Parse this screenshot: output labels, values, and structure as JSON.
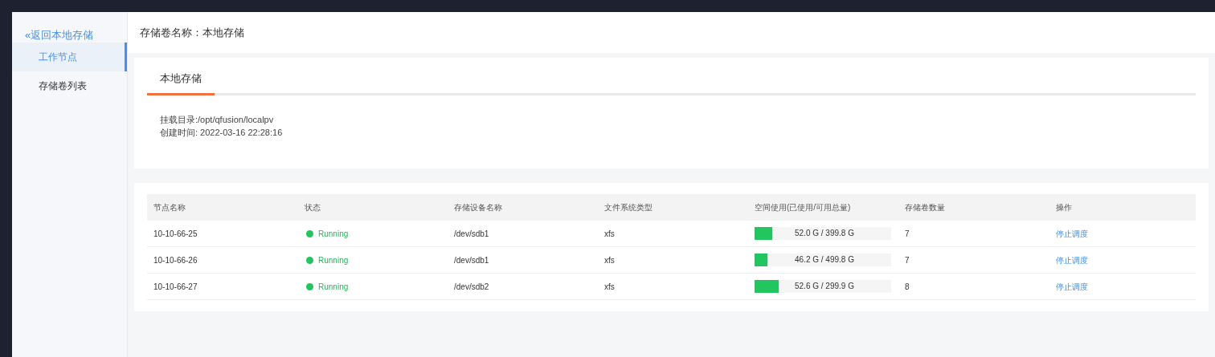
{
  "sidebar": {
    "back_link": "«返回本地存储",
    "items": [
      {
        "label": "工作节点",
        "selected": true
      },
      {
        "label": "存储卷列表",
        "selected": false
      }
    ]
  },
  "header": {
    "title": "存储卷名称：本地存储"
  },
  "info_card": {
    "tabs": [
      {
        "label": "本地存储",
        "selected": true
      }
    ],
    "lines": [
      "挂载目录:/opt/qfusion/localpv",
      "创建时间: 2022-03-16 22:28:16"
    ]
  },
  "table": {
    "columns": [
      "节点名称",
      "状态",
      "存储设备名称",
      "文件系统类型",
      "空间使用(已使用/可用总量)",
      "存储卷数量",
      "操作"
    ],
    "rows": [
      {
        "node": "10-10-66-25",
        "status": {
          "text": "Running",
          "kind": "running"
        },
        "device": "/dev/sdb1",
        "fs": "xfs",
        "usage": {
          "level": 0.13,
          "text": "52.0 G / 399.8 G"
        },
        "volumes": "7",
        "action": "停止调度"
      },
      {
        "node": "10-10-66-26",
        "status": {
          "text": "Running",
          "kind": "running"
        },
        "device": "/dev/sdb1",
        "fs": "xfs",
        "usage": {
          "level": 0.092,
          "text": "46.2 G / 499.8 G"
        },
        "volumes": "7",
        "action": "停止调度"
      },
      {
        "node": "10-10-66-27",
        "status": {
          "text": "Running",
          "kind": "running"
        },
        "device": "/dev/sdb2",
        "fs": "xfs",
        "usage": {
          "level": 0.175,
          "text": "52.6 G / 299.9 G"
        },
        "volumes": "8",
        "action": "停止调度"
      }
    ]
  }
}
